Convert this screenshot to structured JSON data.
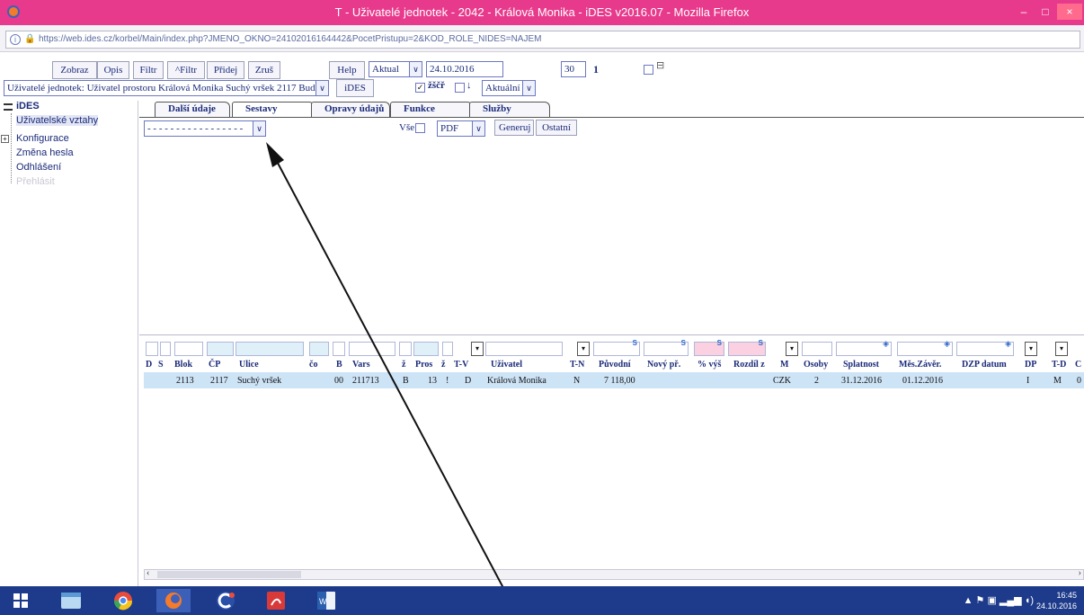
{
  "window": {
    "title": "T - Uživatelé jednotek - 2042 - Králová Monika - iDES v2016.07 - Mozilla Firefox",
    "controls": [
      "–",
      "□",
      "×"
    ]
  },
  "browser": {
    "url_host": "https://web.ides.cz",
    "url_path": "/korbel/Main/index.php?JMENO_OKNO=24102016164442&PocetPristupu=2&KOD_ROLE_NIDES=NAJEM"
  },
  "toolbar": {
    "zobraz": "Zobraz",
    "opis": "Opis",
    "filtr": "Filtr",
    "not_filtr": "^Filtr",
    "pridej": "Přidej",
    "zrus": "Zruš",
    "help": "Help",
    "aktual": "Aktual",
    "date": "24.10.2016",
    "page_size": "30",
    "page_number": "1",
    "context_select": "Uživatelé jednotek: Uživatel prostoru Králová Monika Suchý vršek 2117 Bud",
    "ides_button": "iDES",
    "zscr_label": "žščř",
    "down_label": "↓",
    "aktualni": "Aktuální"
  },
  "tree": {
    "root": "iDES",
    "items": [
      "Uživatelské vztahy",
      "Konfigurace",
      "Změna hesla",
      "Odhlášení",
      "Přehlásit"
    ]
  },
  "tabs": [
    "Další údaje",
    "Sestavy",
    "Opravy údajů",
    "Funkce",
    "Služby"
  ],
  "sestavy": {
    "report_select": "- - - - - - - - - - - - - - - - -",
    "vse_label": "Vše",
    "format": "PDF",
    "generuj": "Generuj",
    "ostatni": "Ostatní"
  },
  "grid": {
    "s_marker": "S",
    "columns": [
      "D",
      "S",
      "Blok",
      "ČP",
      "Ulice",
      "čo",
      "B",
      "Vars",
      "ž",
      "Pros",
      "ž",
      "T-V",
      "Uživatel",
      "T-N",
      "Původní",
      "Nový př.",
      "% výš",
      "Rozdíl z",
      "M",
      "Osoby",
      "Splatnost",
      "Měs.Závěr.",
      "DZP datum",
      "DP",
      "T-D",
      "C"
    ],
    "rows": [
      {
        "blok": "2113",
        "cp": "2117",
        "ulice": "Suchý vršek",
        "co": "00",
        "vars": "211713",
        "z1": "B",
        "pros": "13",
        "z2": "!",
        "tv": "D",
        "uzivatel": "Králová Monika",
        "tn": "N",
        "puvodni": "7 118,00",
        "m": "CZK",
        "osoby": "2",
        "splatnost": "31.12.2016",
        "mes_zaver": "01.12.2016",
        "dp": "I",
        "td": "M",
        "c": "0"
      }
    ]
  },
  "taskbar": {
    "time": "16:45",
    "date": "24.10.2016"
  }
}
